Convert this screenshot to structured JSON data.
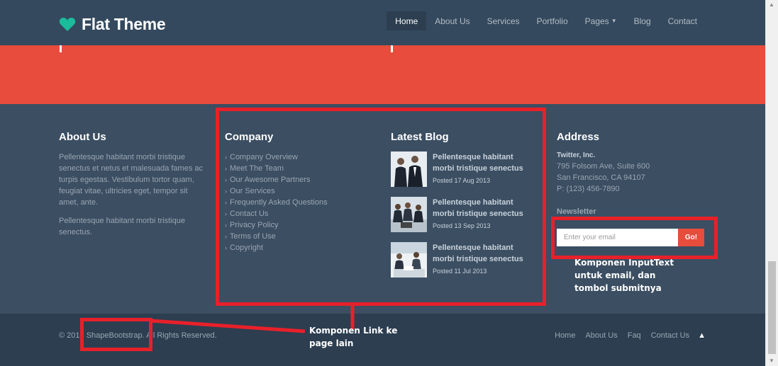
{
  "header": {
    "brand": "Flat Theme",
    "nav": [
      {
        "label": "Home",
        "active": true
      },
      {
        "label": "About Us"
      },
      {
        "label": "Services"
      },
      {
        "label": "Portfolio"
      },
      {
        "label": "Pages"
      },
      {
        "label": "Blog"
      },
      {
        "label": "Contact"
      }
    ]
  },
  "footer": {
    "about": {
      "title": "About Us",
      "p1": "Pellentesque habitant morbi tristique senectus et netus et malesuada fames ac turpis egestas. Vestibulum tortor quam, feugiat vitae, ultricies eget, tempor sit amet, ante.",
      "p2": "Pellentesque habitant morbi tristique senectus."
    },
    "company": {
      "title": "Company",
      "links": [
        "Company Overview",
        "Meet The Team",
        "Our Awesome Partners",
        "Our Services",
        "Frequently Asked Questions",
        "Contact Us",
        "Privacy Policy",
        "Terms of Use",
        "Copyright"
      ]
    },
    "blog": {
      "title": "Latest Blog",
      "posts": [
        {
          "title": "Pellentesque habitant morbi tristique senectus",
          "date": "Posted 17 Aug 2013"
        },
        {
          "title": "Pellentesque habitant morbi tristique senectus",
          "date": "Posted 13 Sep 2013"
        },
        {
          "title": "Pellentesque habitant morbi tristique senectus",
          "date": "Posted 11 Jul 2013"
        }
      ]
    },
    "address": {
      "title": "Address",
      "company": "Twitter, Inc.",
      "line1": "795 Folsom Ave, Suite 600",
      "line2": "San Francisco, CA 94107",
      "phone": "P: (123) 456-7890"
    },
    "newsletter": {
      "title": "Newsletter",
      "placeholder": "Enter your email",
      "button": "Go!"
    }
  },
  "copyright": {
    "text": "© 2013 ShapeBootstrap. All Rights Reserved.",
    "links": [
      "Home",
      "About Us",
      "Faq",
      "Contact Us"
    ]
  },
  "annotations": {
    "link_note_1": "Komponen Link ke",
    "link_note_2": "page lain",
    "input_note_1": "Komponen InputText",
    "input_note_2": "untuk email, dan",
    "input_note_3": "tombol submitnya"
  },
  "colors": {
    "accent": "#e74c3c",
    "dark": "#34495e",
    "heart": "#1abc9c",
    "annotation": "#e8202a"
  }
}
